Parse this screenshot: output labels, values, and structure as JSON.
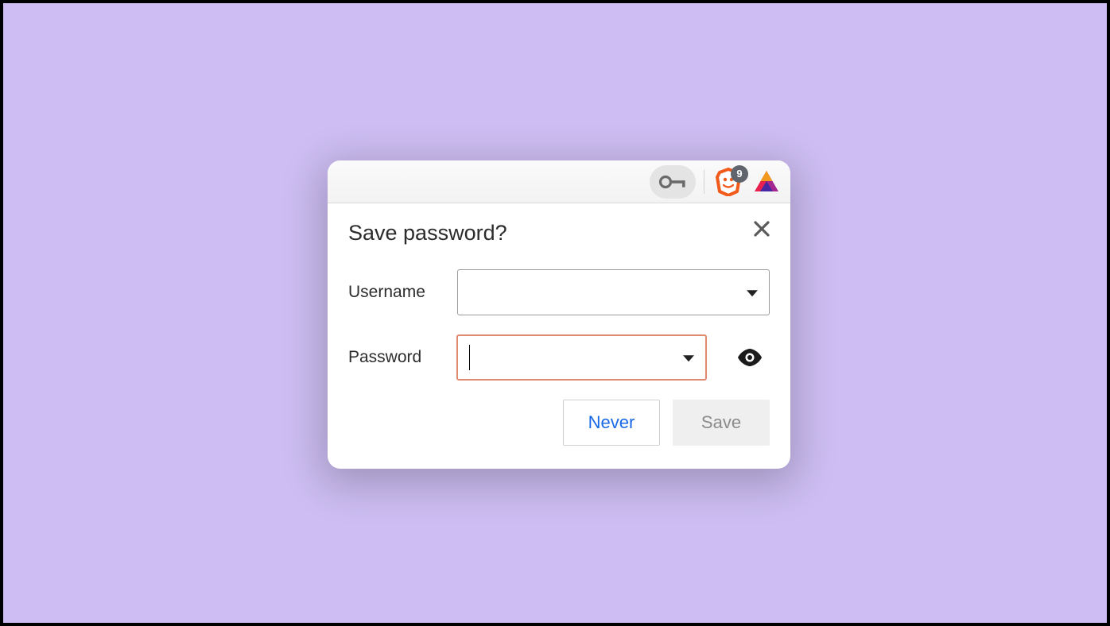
{
  "toolbar": {
    "key_icon": "key-icon",
    "shield_icon": "brave-shield-icon",
    "shield_badge_count": "9",
    "brave_icon": "brave-rewards-icon"
  },
  "dialog": {
    "title": "Save password?",
    "close_icon": "close-icon",
    "username_label": "Username",
    "username_value": "",
    "password_label": "Password",
    "password_value": "",
    "eye_icon": "eye-icon",
    "never_label": "Never",
    "save_label": "Save"
  }
}
